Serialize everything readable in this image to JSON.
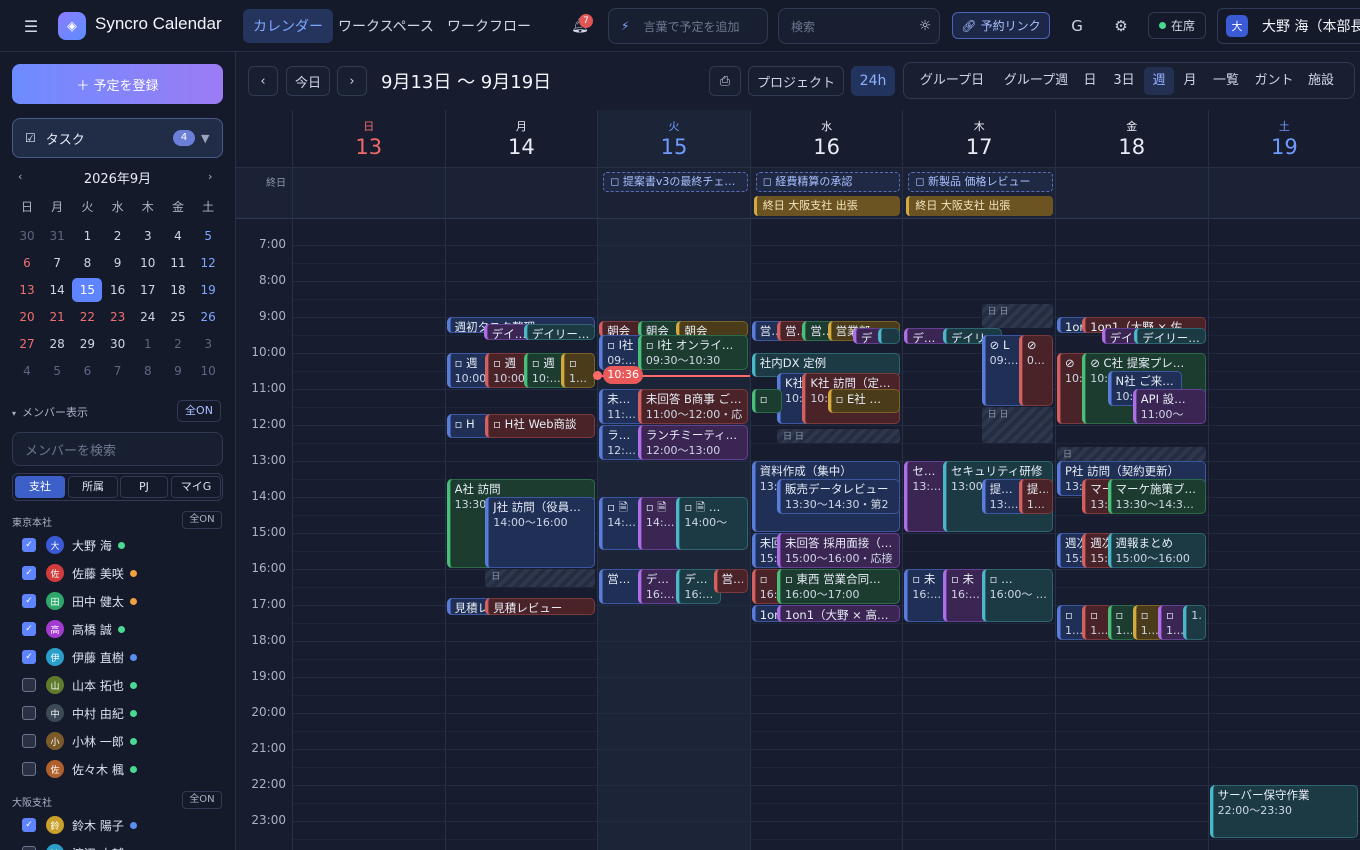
{
  "header": {
    "menu_icon": "menu-icon",
    "app_title": "Syncro Calendar",
    "tabs": [
      "カレンダー",
      "ワークスペース",
      "ワークフロー"
    ],
    "notif_count": "7",
    "quick_add_placeholder": "言葉で予定を追加",
    "search_placeholder": "検索",
    "booking_link": "予約リンク",
    "g_label": "G",
    "status": "在席",
    "user_initial": "大",
    "user_name": "大野 海（本部長"
  },
  "sidebar": {
    "add_button": "＋ 予定を登録",
    "tasks_label": "タスク",
    "tasks_count": "4",
    "month_label": "2026年9月",
    "weekdays": [
      "日",
      "月",
      "火",
      "水",
      "木",
      "金",
      "土"
    ],
    "days": [
      [
        "30",
        "31",
        "1",
        "2",
        "3",
        "4",
        "5"
      ],
      [
        "6",
        "7",
        "8",
        "9",
        "10",
        "11",
        "12"
      ],
      [
        "13",
        "14",
        "15",
        "16",
        "17",
        "18",
        "19"
      ],
      [
        "20",
        "21",
        "22",
        "23",
        "24",
        "25",
        "26"
      ],
      [
        "27",
        "28",
        "29",
        "30",
        "1",
        "2",
        "3"
      ],
      [
        "4",
        "5",
        "6",
        "7",
        "8",
        "9",
        "10"
      ]
    ],
    "member_section": "メンバー表示",
    "all_on": "全ON",
    "member_search_placeholder": "メンバーを検索",
    "filters": [
      "支社",
      "所属",
      "PJ",
      "マイG"
    ],
    "group1": "東京本社",
    "group1_all": "全ON",
    "members": [
      {
        "i": "大",
        "name": "大野 海",
        "on": true,
        "c": "#3b5bd6",
        "s": "#4ad991"
      },
      {
        "i": "佐",
        "name": "佐藤 美咲",
        "on": true,
        "c": "#d13b3b",
        "s": "#f0a040"
      },
      {
        "i": "田",
        "name": "田中 健太",
        "on": true,
        "c": "#2ea86a",
        "s": "#f0a040"
      },
      {
        "i": "高",
        "name": "高橋 誠",
        "on": true,
        "c": "#a33bd1",
        "s": "#4ad991"
      },
      {
        "i": "伊",
        "name": "伊藤 直樹",
        "on": true,
        "c": "#2a9fc9",
        "s": "#5a8ff0"
      },
      {
        "i": "山",
        "name": "山本 拓也",
        "on": false,
        "c": "#5e7a2a",
        "s": "#4ad991"
      },
      {
        "i": "中",
        "name": "中村 由紀",
        "on": false,
        "c": "#3b4a55",
        "s": "#4ad991"
      },
      {
        "i": "小",
        "name": "小林 一郎",
        "on": false,
        "c": "#7a5a2a",
        "s": "#4ad991"
      },
      {
        "i": "佐",
        "name": "佐々木 楓",
        "on": false,
        "c": "#b0602a",
        "s": "#4ad991"
      }
    ],
    "group2": "大阪支社",
    "group2_all": "全ON",
    "members2": [
      {
        "i": "鈴",
        "name": "鈴木 陽子",
        "on": true,
        "c": "#c9a02a",
        "s": "#5a8ff0"
      },
      {
        "i": "渡",
        "name": "渡辺 大輔",
        "on": false,
        "c": "#2a9fc9",
        "s": "#4ad991"
      }
    ]
  },
  "toolbar": {
    "today": "今日",
    "range": "9月13日 〜 9月19日",
    "project": "プロジェクト",
    "h24": "24h",
    "views": [
      "グループ日",
      "グループ週",
      "日",
      "3日",
      "週",
      "月",
      "一覧",
      "ガント",
      "施設"
    ],
    "active_view": "週"
  },
  "days": [
    {
      "w": "日",
      "d": "13",
      "color": "#f06a6a"
    },
    {
      "w": "月",
      "d": "14",
      "color": "#e8ecf5"
    },
    {
      "w": "火",
      "d": "15",
      "color": "#6f9bff"
    },
    {
      "w": "水",
      "d": "16",
      "color": "#e8ecf5"
    },
    {
      "w": "木",
      "d": "17",
      "color": "#e8ecf5"
    },
    {
      "w": "金",
      "d": "18",
      "color": "#e8ecf5"
    },
    {
      "w": "土",
      "d": "19",
      "color": "#6f9bff"
    }
  ],
  "allday_label": "終日",
  "allday_events": [
    {
      "day": 2,
      "text": "◻ 提案書v3の最終チェ…"
    },
    {
      "day": 3,
      "text": "◻ 経費精算の承認"
    },
    {
      "day": 4,
      "text": "◻ 新製品 価格レビュー"
    }
  ],
  "allday_trips": [
    {
      "day": 3,
      "text": "終日 大阪支社 出張"
    },
    {
      "day": 4,
      "text": "終日 大阪支社 出張"
    }
  ],
  "times": [
    "7:00",
    "8:00",
    "9:00",
    "10:00",
    "11:00",
    "12:00",
    "13:00",
    "14:00",
    "15:00",
    "16:00",
    "17:00",
    "18:00",
    "19:00",
    "20:00",
    "21:00",
    "22:00",
    "23:00"
  ],
  "now_label": "10:36",
  "events": [
    {
      "d": 1,
      "s": 9.0,
      "e": 9.4,
      "o": 0,
      "w": 1,
      "c": "blue",
      "t": "週初タスク整理",
      "sub": ""
    },
    {
      "d": 1,
      "s": 9.2,
      "e": 9.5,
      "o": 0.25,
      "w": 0.35,
      "c": "purple",
      "t": "デイリ…",
      "sub": ""
    },
    {
      "d": 1,
      "s": 9.2,
      "e": 9.5,
      "o": 0.52,
      "w": 0.48,
      "c": "teal",
      "t": "デイリー…",
      "sub": ""
    },
    {
      "d": 1,
      "s": 10.0,
      "e": 11.0,
      "o": 0,
      "w": 0.35,
      "c": "blue",
      "t": "▫ 週",
      "sub": "10:00"
    },
    {
      "d": 1,
      "s": 10.0,
      "e": 11.0,
      "o": 0.26,
      "w": 0.35,
      "c": "red",
      "t": "▫ 週",
      "sub": "10:00"
    },
    {
      "d": 1,
      "s": 10.0,
      "e": 11.0,
      "o": 0.52,
      "w": 0.3,
      "c": "green",
      "t": "▫ 週",
      "sub": "10:00"
    },
    {
      "d": 1,
      "s": 10.0,
      "e": 11.0,
      "o": 0.77,
      "w": 0.23,
      "c": "gold",
      "t": "▫",
      "sub": "10:0"
    },
    {
      "d": 1,
      "s": 11.7,
      "e": 12.4,
      "o": 0,
      "w": 0.3,
      "c": "blue",
      "t": "▫ H",
      "sub": ""
    },
    {
      "d": 1,
      "s": 11.7,
      "e": 12.4,
      "o": 0.26,
      "w": 0.74,
      "c": "red",
      "t": "▫ H社 Web商談",
      "sub": ""
    },
    {
      "d": 1,
      "s": 13.5,
      "e": 16.0,
      "o": 0,
      "w": 1,
      "c": "green",
      "t": "A社 訪問",
      "sub": "13:30〜（プリ"
    },
    {
      "d": 1,
      "s": 14.0,
      "e": 16.0,
      "o": 0.26,
      "w": 0.74,
      "c": "blue",
      "t": "J社 訪問（役員…",
      "sub": "14:00〜16:00"
    },
    {
      "d": 1,
      "s": 16.8,
      "e": 17.3,
      "o": 0,
      "w": 0.35,
      "c": "blue",
      "t": "見積レ",
      "sub": ""
    },
    {
      "d": 1,
      "s": 16.8,
      "e": 17.3,
      "o": 0.26,
      "w": 0.74,
      "c": "red",
      "t": "見積レビュー",
      "sub": ""
    },
    {
      "d": 2,
      "s": 9.1,
      "e": 9.5,
      "o": 0,
      "w": 0.28,
      "c": "red",
      "t": "朝会",
      "sub": ""
    },
    {
      "d": 2,
      "s": 9.1,
      "e": 9.5,
      "o": 0.26,
      "w": 0.3,
      "c": "green",
      "t": "朝会",
      "sub": ""
    },
    {
      "d": 2,
      "s": 9.1,
      "e": 9.5,
      "o": 0.52,
      "w": 0.48,
      "c": "gold",
      "t": "朝会",
      "sub": ""
    },
    {
      "d": 2,
      "s": 9.5,
      "e": 10.5,
      "o": 0,
      "w": 0.3,
      "c": "blue",
      "t": "▫ I社",
      "sub": "09:30"
    },
    {
      "d": 2,
      "s": 9.5,
      "e": 10.5,
      "o": 0.26,
      "w": 0.74,
      "c": "green",
      "t": "▫ I社 オンライ…",
      "sub": "09:30〜10:30"
    },
    {
      "d": 2,
      "s": 11.0,
      "e": 12.0,
      "o": 0,
      "w": 0.3,
      "c": "blue",
      "t": "未回答",
      "sub": "11:00"
    },
    {
      "d": 2,
      "s": 11.0,
      "e": 12.0,
      "o": 0.26,
      "w": 0.74,
      "c": "red",
      "t": "未回答 B商事 ご…",
      "sub": "11:00〜12:00・応"
    },
    {
      "d": 2,
      "s": 12.0,
      "e": 13.0,
      "o": 0,
      "w": 0.3,
      "c": "blue",
      "t": "ランチ",
      "sub": "12:00"
    },
    {
      "d": 2,
      "s": 12.0,
      "e": 13.0,
      "o": 0.26,
      "w": 0.74,
      "c": "purple",
      "t": "ランチミーティ…",
      "sub": "12:00〜13:00"
    },
    {
      "d": 2,
      "s": 14.0,
      "e": 15.5,
      "o": 0,
      "w": 0.3,
      "c": "blue",
      "t": "▫ 🗎",
      "sub": "14:00"
    },
    {
      "d": 2,
      "s": 14.0,
      "e": 15.5,
      "o": 0.26,
      "w": 0.3,
      "c": "purple",
      "t": "▫ 🗎",
      "sub": "14:00〜"
    },
    {
      "d": 2,
      "s": 14.0,
      "e": 15.5,
      "o": 0.52,
      "w": 0.48,
      "c": "teal",
      "t": "▫ 🗎 …",
      "sub": "14:00〜"
    },
    {
      "d": 2,
      "s": 16.0,
      "e": 17.0,
      "o": 0,
      "w": 0.3,
      "c": "blue",
      "t": "営業数",
      "sub": ""
    },
    {
      "d": 2,
      "s": 16.0,
      "e": 17.0,
      "o": 0.26,
      "w": 0.3,
      "c": "purple",
      "t": "デザイ",
      "sub": "16:00"
    },
    {
      "d": 2,
      "s": 16.0,
      "e": 17.0,
      "o": 0.52,
      "w": 0.3,
      "c": "teal",
      "t": "デザイ",
      "sub": "16:00"
    },
    {
      "d": 2,
      "s": 16.0,
      "e": 16.7,
      "o": 0.77,
      "w": 0.23,
      "c": "red",
      "t": "営…",
      "sub": ""
    },
    {
      "d": 3,
      "s": 9.1,
      "e": 9.7,
      "o": 0,
      "w": 0.22,
      "c": "blue",
      "t": "営業",
      "sub": ""
    },
    {
      "d": 3,
      "s": 9.1,
      "e": 9.7,
      "o": 0.17,
      "w": 0.22,
      "c": "red",
      "t": "営業",
      "sub": ""
    },
    {
      "d": 3,
      "s": 9.1,
      "e": 9.7,
      "o": 0.34,
      "w": 0.22,
      "c": "green",
      "t": "営業",
      "sub": ""
    },
    {
      "d": 3,
      "s": 9.1,
      "e": 9.7,
      "o": 0.51,
      "w": 0.49,
      "c": "gold",
      "t": "営業部",
      "sub": ""
    },
    {
      "d": 3,
      "s": 9.3,
      "e": 9.7,
      "o": 0.68,
      "w": 0.2,
      "c": "purple",
      "t": "デ",
      "sub": ""
    },
    {
      "d": 3,
      "s": 9.3,
      "e": 9.7,
      "o": 0.85,
      "w": 0.15,
      "c": "teal",
      "t": "",
      "sub": ""
    },
    {
      "d": 3,
      "s": 10.0,
      "e": 10.7,
      "o": 0,
      "w": 1,
      "c": "teal",
      "t": "社内DX 定例",
      "sub": ""
    },
    {
      "d": 3,
      "s": 10.55,
      "e": 12.0,
      "o": 0.17,
      "w": 0.33,
      "c": "blue",
      "t": "K社",
      "sub": "10:"
    },
    {
      "d": 3,
      "s": 10.55,
      "e": 12.0,
      "o": 0.34,
      "w": 0.66,
      "c": "red",
      "t": "K社 訪問（定…",
      "sub": "10:"
    },
    {
      "d": 3,
      "s": 11.0,
      "e": 11.7,
      "o": 0.51,
      "w": 0.49,
      "c": "gold",
      "t": "▫ E社 …",
      "sub": ""
    },
    {
      "d": 3,
      "s": 11.0,
      "e": 11.7,
      "o": 0,
      "w": 0.2,
      "c": "green",
      "t": "▫",
      "sub": ""
    },
    {
      "d": 3,
      "s": 13.0,
      "e": 15.0,
      "o": 0,
      "w": 1,
      "c": "blue",
      "t": "資料作成（集中）",
      "sub": "13:"
    },
    {
      "d": 3,
      "s": 13.5,
      "e": 14.5,
      "o": 0.17,
      "w": 0.83,
      "c": "blue",
      "t": "販売データレビュー",
      "sub": "13:30〜14:30・第2"
    },
    {
      "d": 3,
      "s": 15.0,
      "e": 16.0,
      "o": 0,
      "w": 0.3,
      "c": "blue",
      "t": "未回",
      "sub": "15:"
    },
    {
      "d": 3,
      "s": 15.0,
      "e": 16.0,
      "o": 0.17,
      "w": 0.83,
      "c": "purple",
      "t": "未回答 採用面接（…",
      "sub": "15:00〜16:00・応接"
    },
    {
      "d": 3,
      "s": 16.0,
      "e": 17.0,
      "o": 0,
      "w": 0.3,
      "c": "red",
      "t": "▫",
      "sub": "16:"
    },
    {
      "d": 3,
      "s": 16.0,
      "e": 17.0,
      "o": 0.17,
      "w": 0.83,
      "c": "green",
      "t": "▫ 東西 営業合同…",
      "sub": "16:00〜17:00"
    },
    {
      "d": 3,
      "s": 17.0,
      "e": 17.5,
      "o": 0,
      "w": 0.3,
      "c": "blue",
      "t": "1on",
      "sub": ""
    },
    {
      "d": 3,
      "s": 17.0,
      "e": 17.5,
      "o": 0.17,
      "w": 0.83,
      "c": "purple",
      "t": "1on1（大野 × 高…",
      "sub": ""
    },
    {
      "d": 4,
      "s": 9.3,
      "e": 9.7,
      "o": 0,
      "w": 0.3,
      "c": "purple",
      "t": "デイリ",
      "sub": ""
    },
    {
      "d": 4,
      "s": 9.3,
      "e": 9.7,
      "o": 0.26,
      "w": 0.4,
      "c": "teal",
      "t": "デイリ",
      "sub": ""
    },
    {
      "d": 4,
      "s": 9.5,
      "e": 11.5,
      "o": 0.52,
      "w": 0.3,
      "c": "blue",
      "t": "⊘ L",
      "sub": "09:30〜11:30"
    },
    {
      "d": 4,
      "s": 9.5,
      "e": 11.5,
      "o": 0.77,
      "w": 0.23,
      "c": "red",
      "t": "⊘",
      "sub": "09:3 11:3"
    },
    {
      "d": 4,
      "s": 13.0,
      "e": 15.0,
      "o": 0,
      "w": 0.3,
      "c": "purple",
      "t": "セキュ",
      "sub": "13:00"
    },
    {
      "d": 4,
      "s": 13.0,
      "e": 15.0,
      "o": 0.26,
      "w": 0.74,
      "c": "teal",
      "t": "セキュリティ研修",
      "sub": "13:00〜 1会議"
    },
    {
      "d": 4,
      "s": 13.5,
      "e": 14.5,
      "o": 0.52,
      "w": 0.3,
      "c": "blue",
      "t": "提案書",
      "sub": "13:30"
    },
    {
      "d": 4,
      "s": 13.5,
      "e": 14.5,
      "o": 0.77,
      "w": 0.23,
      "c": "red",
      "t": "提…",
      "sub": "13:3"
    },
    {
      "d": 4,
      "s": 16.0,
      "e": 17.5,
      "o": 0,
      "w": 0.3,
      "c": "blue",
      "t": "▫ 未",
      "sub": "16:00"
    },
    {
      "d": 4,
      "s": 16.0,
      "e": 17.5,
      "o": 0.26,
      "w": 0.3,
      "c": "purple",
      "t": "▫ 未",
      "sub": "16:00 1会議"
    },
    {
      "d": 4,
      "s": 16.0,
      "e": 17.5,
      "o": 0.52,
      "w": 0.48,
      "c": "teal",
      "t": "▫ …",
      "sub": "16:00〜 17:30・第"
    },
    {
      "d": 5,
      "s": 9.0,
      "e": 9.4,
      "o": 0,
      "w": 0.3,
      "c": "blue",
      "t": "1on",
      "sub": ""
    },
    {
      "d": 5,
      "s": 9.0,
      "e": 9.4,
      "o": 0.17,
      "w": 0.83,
      "c": "red",
      "t": "1on1（大野 × 佐",
      "sub": ""
    },
    {
      "d": 5,
      "s": 9.3,
      "e": 9.7,
      "o": 0.3,
      "w": 0.3,
      "c": "purple",
      "t": "デイ",
      "sub": ""
    },
    {
      "d": 5,
      "s": 9.3,
      "e": 9.7,
      "o": 0.52,
      "w": 0.48,
      "c": "teal",
      "t": "デイリー…",
      "sub": ""
    },
    {
      "d": 5,
      "s": 10.0,
      "e": 12.0,
      "o": 0,
      "w": 0.3,
      "c": "red",
      "t": "⊘",
      "sub": "10:（ブ"
    },
    {
      "d": 5,
      "s": 10.0,
      "e": 12.0,
      "o": 0.17,
      "w": 0.83,
      "c": "green",
      "t": "⊘ C社 提案プレ…",
      "sub": "10: 車"
    },
    {
      "d": 5,
      "s": 10.5,
      "e": 11.5,
      "o": 0.34,
      "w": 0.5,
      "c": "blue",
      "t": "N社 ご来社（…",
      "sub": "10:"
    },
    {
      "d": 5,
      "s": 11.0,
      "e": 12.0,
      "o": 0.51,
      "w": 0.49,
      "c": "purple",
      "t": "API 設…",
      "sub": "11:00〜"
    },
    {
      "d": 5,
      "s": 13.0,
      "e": 14.0,
      "o": 0,
      "w": 1,
      "c": "blue",
      "t": "P社 訪問（契約更新）",
      "sub": "13:"
    },
    {
      "d": 5,
      "s": 13.5,
      "e": 14.5,
      "o": 0.17,
      "w": 0.3,
      "c": "red",
      "t": "マー",
      "sub": "13:"
    },
    {
      "d": 5,
      "s": 13.5,
      "e": 14.5,
      "o": 0.34,
      "w": 0.66,
      "c": "green",
      "t": "マーケ施策ブ…",
      "sub": "13:30〜14:30・"
    },
    {
      "d": 5,
      "s": 15.0,
      "e": 16.0,
      "o": 0,
      "w": 0.3,
      "c": "blue",
      "t": "週次",
      "sub": "15:"
    },
    {
      "d": 5,
      "s": 15.0,
      "e": 16.0,
      "o": 0.17,
      "w": 0.3,
      "c": "red",
      "t": "週次",
      "sub": "15:"
    },
    {
      "d": 5,
      "s": 15.0,
      "e": 16.0,
      "o": 0.34,
      "w": 0.66,
      "c": "teal",
      "t": "週報まとめ",
      "sub": "15:00〜16:00"
    },
    {
      "d": 5,
      "s": 17.0,
      "e": 18.0,
      "o": 0,
      "w": 0.2,
      "c": "blue",
      "t": "▫",
      "sub": "17:"
    },
    {
      "d": 5,
      "s": 17.0,
      "e": 18.0,
      "o": 0.17,
      "w": 0.2,
      "c": "red",
      "t": "▫",
      "sub": "17:"
    },
    {
      "d": 5,
      "s": 17.0,
      "e": 18.0,
      "o": 0.34,
      "w": 0.2,
      "c": "green",
      "t": "▫",
      "sub": "17:"
    },
    {
      "d": 5,
      "s": 17.0,
      "e": 18.0,
      "o": 0.51,
      "w": 0.2,
      "c": "gold",
      "t": "▫",
      "sub": "17:"
    },
    {
      "d": 5,
      "s": 17.0,
      "e": 18.0,
      "o": 0.68,
      "w": 0.2,
      "c": "purple",
      "t": "▫",
      "sub": "17:"
    },
    {
      "d": 5,
      "s": 17.0,
      "e": 18.0,
      "o": 0.85,
      "w": 0.15,
      "c": "teal",
      "t": "",
      "sub": "17"
    },
    {
      "d": 6,
      "s": 22.0,
      "e": 23.5,
      "o": 0,
      "w": 1,
      "c": "teal",
      "t": "サーバー保守作業",
      "sub": "22:00〜23:30"
    }
  ],
  "hatches": [
    {
      "d": 1,
      "s": 16.0,
      "e": 16.5,
      "o": 0.26,
      "w": 0.74,
      "txt": "日"
    },
    {
      "d": 3,
      "s": 12.1,
      "e": 12.5,
      "o": 0.17,
      "w": 0.83,
      "txt": "日 日"
    },
    {
      "d": 4,
      "s": 8.65,
      "e": 9.3,
      "o": 0.52,
      "w": 0.48,
      "txt": "日 日"
    },
    {
      "d": 4,
      "s": 11.5,
      "e": 12.5,
      "o": 0.52,
      "w": 0.48,
      "txt": "日 日"
    },
    {
      "d": 5,
      "s": 12.6,
      "e": 13.0,
      "o": 0,
      "w": 1,
      "txt": "日"
    },
    {
      "d": 3,
      "s": 10.0,
      "e": 10.6,
      "o": 0.5,
      "w": 0.5,
      "txt": ""
    },
    {
      "d": 1,
      "s": 13.5,
      "e": 13.9,
      "o": 0.5,
      "w": 0.5,
      "txt": ""
    }
  ]
}
